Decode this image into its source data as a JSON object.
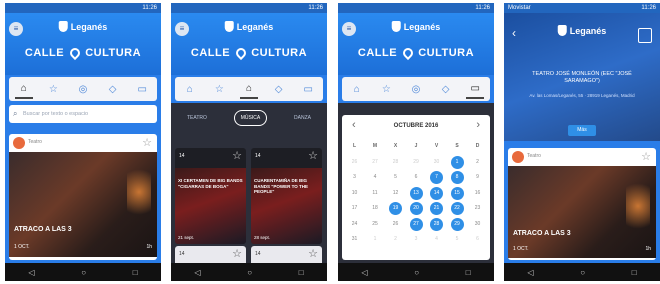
{
  "status": {
    "time": "11:26",
    "carrier_p4": "Movistar"
  },
  "header": {
    "city": "Leganés",
    "brand_left": "CALLE",
    "brand_right": "CULTURA"
  },
  "tab_icons": [
    "home-icon",
    "star-icon",
    "location-icon",
    "ticket-icon",
    "calendar-icon"
  ],
  "screen1": {
    "search_placeholder": "Buscar por texto o espacio",
    "card": {
      "category": "Teatro",
      "title": "ATRACO A LAS 3",
      "date": "1 OCT.",
      "duration": "1h"
    }
  },
  "screen2": {
    "filters": [
      "TEATRO",
      "MÚSICA",
      "DANZA"
    ],
    "cards": [
      {
        "count": "14",
        "title": "XI CERTAMEN DE BIG BANDS \"CIGARRAS DE BOGA\"",
        "date": "21 sept."
      },
      {
        "count": "14",
        "title": "CUARENTAMIÑA DE BIG BANDS \"POWER TO THE PEOPLE\"",
        "date": "28 sept."
      },
      {
        "count": "14",
        "title": "",
        "date": ""
      },
      {
        "count": "14",
        "title": "",
        "date": ""
      }
    ]
  },
  "screen3": {
    "month": "OCTUBRE 2016",
    "weekdays": [
      "L",
      "M",
      "X",
      "J",
      "V",
      "S",
      "D"
    ],
    "weeks": [
      [
        "26",
        "27",
        "28",
        "29",
        "30",
        "1",
        "2"
      ],
      [
        "3",
        "4",
        "5",
        "6",
        "7",
        "8",
        "9"
      ],
      [
        "10",
        "11",
        "12",
        "13",
        "14",
        "15",
        "16"
      ],
      [
        "17",
        "18",
        "19",
        "20",
        "21",
        "22",
        "23"
      ],
      [
        "24",
        "25",
        "26",
        "27",
        "28",
        "29",
        "30"
      ],
      [
        "31",
        "1",
        "2",
        "3",
        "4",
        "5",
        "6"
      ]
    ],
    "marked": [
      "1",
      "7",
      "8",
      "13",
      "14",
      "15",
      "19",
      "20",
      "21",
      "22",
      "27",
      "28",
      "29"
    ]
  },
  "screen4": {
    "status_carrier": "Movistar",
    "hero_title": "TEATRO JOSÉ MONLEÓN (EEC \"JOSÉ SARAMAGO\")",
    "hero_sub": "Av. las Lomas/Leganés, 55 · 28919 Leganés, Madrid",
    "more_label": "Más",
    "card": {
      "category": "Teatro",
      "title": "ATRACO A LAS 3",
      "date": "1 OCT.",
      "duration": "1h"
    }
  }
}
